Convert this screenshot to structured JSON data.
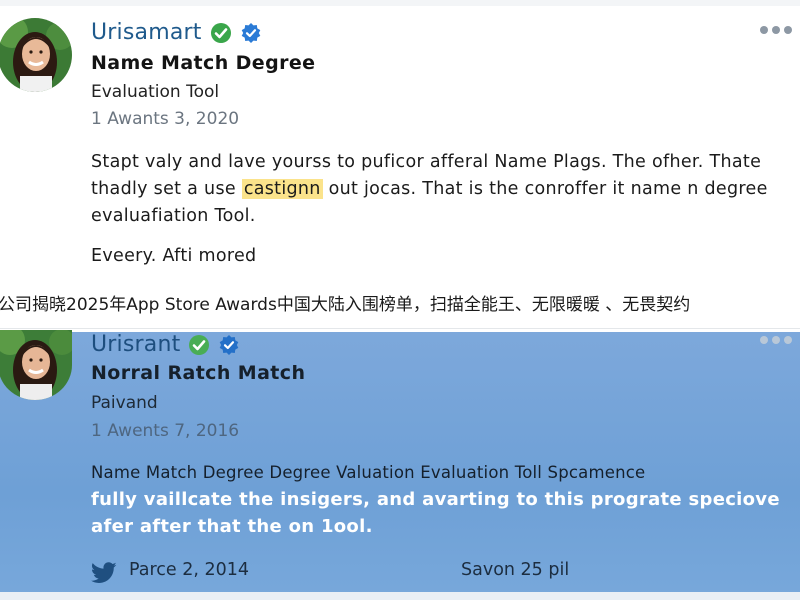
{
  "colors": {
    "username": "#1f5a8c",
    "verified_green": "#3aa64a",
    "verified_blue": "#2b7bd6",
    "highlight": "#fbe38b",
    "card2_background": "#6ea0d6"
  },
  "posts": [
    {
      "avatar_icon": "person-avatar",
      "username": "Urisamart",
      "badges": [
        "check-circle-icon",
        "verified-badge-icon"
      ],
      "title": "Name Match Degree",
      "subtitle": "Evaluation Tool",
      "date": "1 Awants 3, 2020",
      "body_before": "Stapt valy and lave yourss to puficor afferal Name Plags. The ofher. Thate thadly set a use ",
      "body_highlight": "castignn",
      "body_after": " out jocas. That is the conroffer it name n degree evaluafiation Tool.",
      "footer": "Eveery. Afti mored"
    },
    {
      "avatar_icon": "person-avatar",
      "username": "Urisrant",
      "badges": [
        "check-circle-icon",
        "verified-badge-icon"
      ],
      "title": "Norral Ratch Match",
      "subtitle": "Paivand",
      "date": "1 Awents 7, 2016",
      "body_line1": "Name Match Degree Degree Valuation Evaluation Toll Spcamence",
      "body_rest": "fully vaillcate the insigers, and avarting to this prograte speciove afer after that the on 1ool.",
      "footer_icon": "twitter-bird-icon",
      "footer_date": "Parce 2, 2014",
      "footer_meta": "Savon 25 pil"
    }
  ],
  "banner": {
    "text": "公司揭晓2025年App Store Awards中国大陆入围榜单，扫描全能王、无限暖暖 、无畏契约"
  },
  "more_menu_icon": "more-horizontal-icon"
}
